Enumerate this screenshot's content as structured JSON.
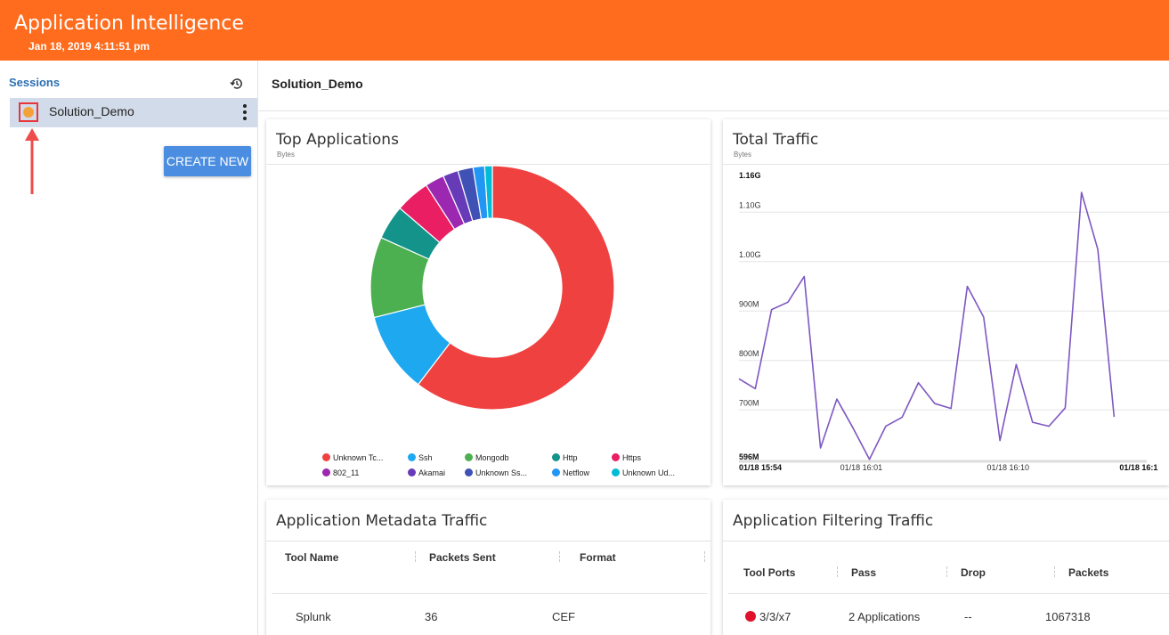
{
  "header": {
    "title": "Application Intelligence",
    "datetime": "Jan 18, 2019 4:11:51 pm",
    "color": "#ff6c1e"
  },
  "sidebar": {
    "sessions_label": "Sessions",
    "history_icon": "history-icon",
    "session": {
      "name": "Solution_Demo",
      "status_color": "#f5a13a"
    },
    "create_button": "CREATE NEW"
  },
  "main": {
    "session_title": "Solution_Demo"
  },
  "top_applications": {
    "title": "Top Applications",
    "unit": "Bytes",
    "legend": [
      {
        "label": "Unknown Tc...",
        "color": "#f04141"
      },
      {
        "label": "Ssh",
        "color": "#1ea8f0"
      },
      {
        "label": "Mongodb",
        "color": "#4caf50"
      },
      {
        "label": "Http",
        "color": "#13938a"
      },
      {
        "label": "Https",
        "color": "#e91e63"
      },
      {
        "label": "802_11",
        "color": "#9c27b0"
      },
      {
        "label": "Akamai",
        "color": "#673ab7"
      },
      {
        "label": "Unknown Ss...",
        "color": "#3f51b5"
      },
      {
        "label": "Netflow",
        "color": "#2196f3"
      },
      {
        "label": "Unknown Ud...",
        "color": "#00bcd4"
      }
    ]
  },
  "total_traffic": {
    "title": "Total Traffic",
    "unit": "Bytes",
    "line_color": "#7e57c2"
  },
  "chart_data": [
    {
      "type": "pie",
      "title": "Top Applications",
      "categories": [
        "Unknown Tc...",
        "Ssh",
        "Mongodb",
        "Http",
        "Https",
        "802_11",
        "Akamai",
        "Unknown Ss...",
        "Netflow",
        "Unknown Ud..."
      ],
      "values": [
        59.5,
        10.5,
        10.5,
        4.5,
        4.5,
        2.5,
        2.0,
        2.0,
        1.5,
        1.0
      ],
      "unit": "%"
    },
    {
      "type": "line",
      "title": "Total Traffic",
      "ylabel": "Bytes",
      "y_tick_labels": [
        "596M",
        "700M",
        "800M",
        "900M",
        "1.00G",
        "1.10G",
        "1.16G"
      ],
      "y_ticks": [
        596,
        700,
        800,
        900,
        1000,
        1100,
        1160
      ],
      "x_tick_labels": [
        "01/18 15:54",
        "01/18 16:01",
        "01/18 16:10",
        "01/18 16:1"
      ],
      "x_ticks": [
        0,
        7.5,
        16.5,
        24.5
      ],
      "ylim": [
        596,
        1160
      ],
      "xlim": [
        0,
        25
      ],
      "series": [
        {
          "values": [
            763,
            743,
            903,
            918,
            970,
            623,
            722,
            663,
            600,
            667,
            685,
            755,
            713,
            703,
            950,
            888,
            638,
            792,
            675,
            667,
            704,
            1140,
            1025,
            686
          ]
        }
      ]
    }
  ],
  "metadata_traffic": {
    "title": "Application Metadata Traffic",
    "columns": [
      "Tool Name",
      "Packets Sent",
      "Format"
    ],
    "rows": [
      [
        "Splunk",
        "36",
        "CEF"
      ]
    ]
  },
  "filtering_traffic": {
    "title": "Application Filtering Traffic",
    "columns": [
      "Tool Ports",
      "Pass",
      "Drop",
      "Packets"
    ],
    "rows": [
      [
        "3/3/x7",
        "2 Applications",
        "--",
        "1067318"
      ]
    ],
    "status_color": "#e0112b"
  }
}
